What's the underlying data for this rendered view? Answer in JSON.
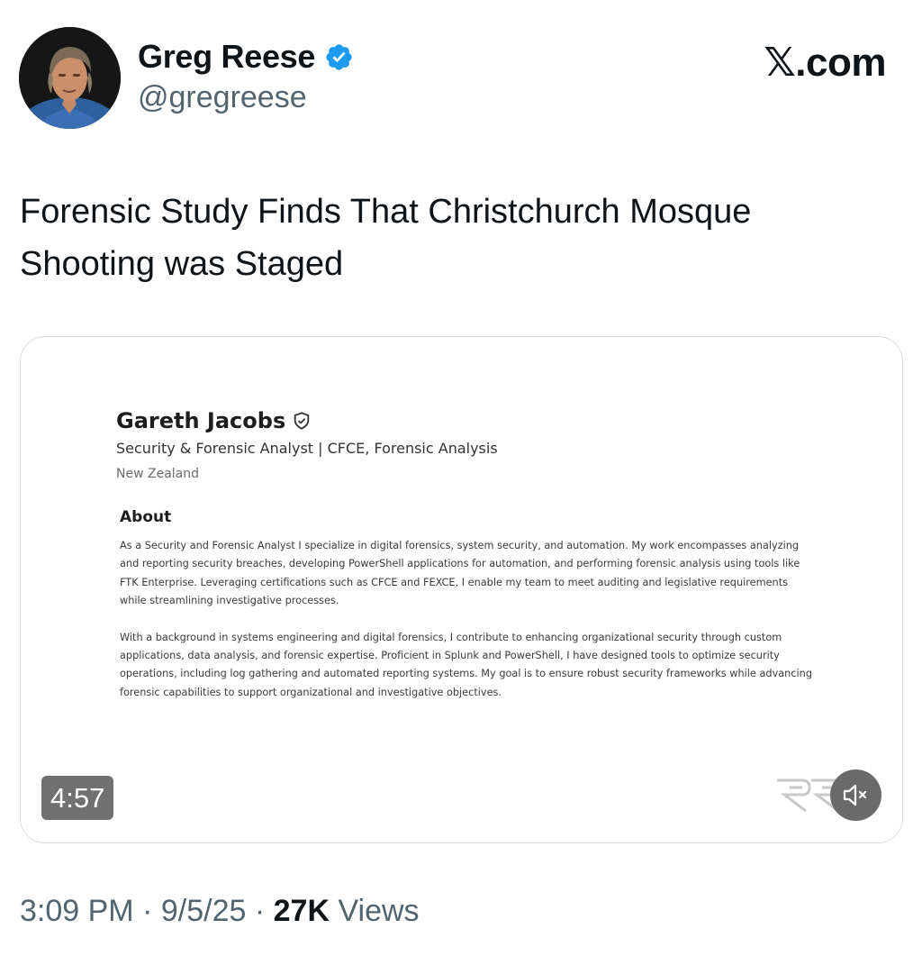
{
  "author": {
    "display_name": "Greg Reese",
    "handle": "@gregreese",
    "avatar_icon": "profile-photo",
    "verified_icon": "verified-badge-icon",
    "verified_color": "#1d9bf0"
  },
  "brand": "𝕏.com",
  "tweet": {
    "text": "Forensic Study Finds That Christchurch Mosque Shooting was Staged"
  },
  "media": {
    "profile": {
      "name": "Gareth Jacobs",
      "badge_icon": "shield-check-icon",
      "title": "Security & Forensic Analyst | CFCE, Forensic Analysis",
      "location": "New Zealand",
      "about_heading": "About",
      "about_paragraphs": [
        "As a Security and Forensic Analyst I specialize in digital forensics, system security, and automation. My work encompasses analyzing and reporting security breaches, developing PowerShell applications for automation, and performing forensic analysis using tools like FTK Enterprise. Leveraging certifications such as CFCE and FEXCE, I enable my team to meet auditing and legislative requirements while streamlining investigative processes.",
        "With a background in systems engineering and digital forensics, I contribute to enhancing organizational security through custom applications, data analysis, and forensic expertise. Proficient in Splunk and PowerShell, I have designed tools to optimize security operations, including log gathering and automated reporting systems. My goal is to ensure robust security frameworks while advancing forensic capabilities to support organizational and investigative objectives."
      ]
    },
    "video_duration": "4:57",
    "watermark_icon": "channel-watermark-logo",
    "mute_icon": "speaker-muted-icon"
  },
  "meta": {
    "time": "3:09 PM",
    "separator": "·",
    "date": "9/5/25",
    "views_count": "27K",
    "views_label": "Views"
  },
  "colors": {
    "text_primary": "#0f1419",
    "text_secondary": "#536471",
    "media_border": "#d8dde1",
    "duration_bg": "#717171",
    "mute_bg": "#6a6a6a"
  }
}
